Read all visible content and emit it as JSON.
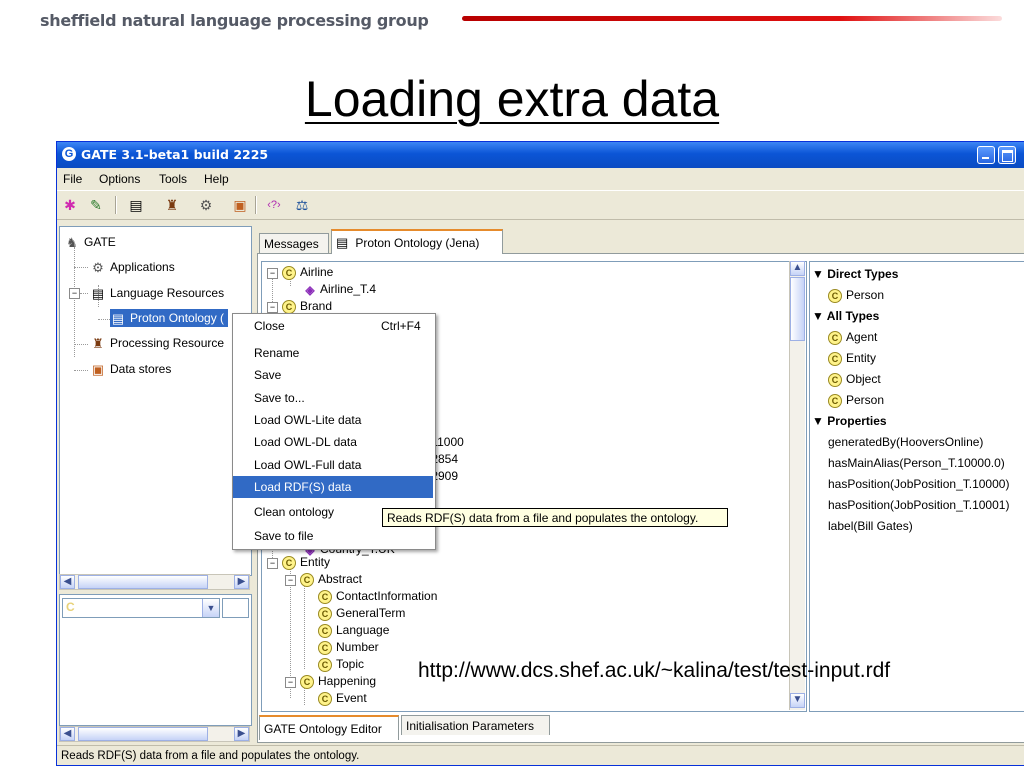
{
  "slide": {
    "header": "sheffield natural language processing group",
    "title": "Loading extra data",
    "caption_url": "http://www.dcs.shef.ac.uk/~kalina/test/test-input.rdf"
  },
  "window": {
    "title": "GATE 3.1-beta1 build 2225",
    "menu": [
      "File",
      "Options",
      "Tools",
      "Help"
    ],
    "status": "Reads RDF(S) data from a file and populates the ontology."
  },
  "resource_tree": {
    "root": "GATE",
    "applications": "Applications",
    "language_resources": "Language Resources",
    "proton_ontology": "Proton Ontology (",
    "processing_resources": "Processing Resource",
    "data_stores": "Data stores"
  },
  "lower_panel": {
    "combo_letter": "C"
  },
  "tabs": {
    "messages": "Messages",
    "proton": "Proton Ontology (Jena)",
    "editor": "GATE Ontology Editor",
    "init": "Initialisation Parameters"
  },
  "ontology_tree": {
    "airline": "Airline",
    "airline_t4": "Airline_T.4",
    "brand": "Brand",
    "partial_1": ".11000",
    "partial_2": ".2854",
    "partial_3": ".2909",
    "partial_country": "Country_T.UK",
    "entity": "Entity",
    "abstract": "Abstract",
    "contact": "ContactInformation",
    "general": "GeneralTerm",
    "language": "Language",
    "number": "Number",
    "topic": "Topic",
    "happening": "Happening",
    "event": "Event"
  },
  "details": {
    "direct_types": "Direct Types",
    "direct_person": "Person",
    "all_types": "All Types",
    "agent": "Agent",
    "entity": "Entity",
    "object": "Object",
    "person": "Person",
    "properties": "Properties",
    "p1": "generatedBy(HooversOnline)",
    "p2": "hasMainAlias(Person_T.10000.0)",
    "p3": "hasPosition(JobPosition_T.10000)",
    "p4": "hasPosition(JobPosition_T.10001)",
    "p5": "label(Bill Gates)"
  },
  "context_menu": {
    "close": "Close",
    "close_shortcut": "Ctrl+F4",
    "rename": "Rename",
    "save": "Save",
    "save_to": "Save to...",
    "load_owl_lite": "Load OWL-Lite data",
    "load_owl_dl": "Load OWL-DL data",
    "load_owl_full": "Load OWL-Full data",
    "load_rdf": "Load RDF(S) data",
    "clean": "Clean ontology",
    "save_file": "Save to file"
  },
  "tooltip": "Reads RDF(S) data from a file and populates the ontology.",
  "colors": {
    "title_bar": "#0b55d6",
    "selection": "#316ac5",
    "header_line": "#e01010",
    "tooltip_bg": "#ffffe1"
  }
}
